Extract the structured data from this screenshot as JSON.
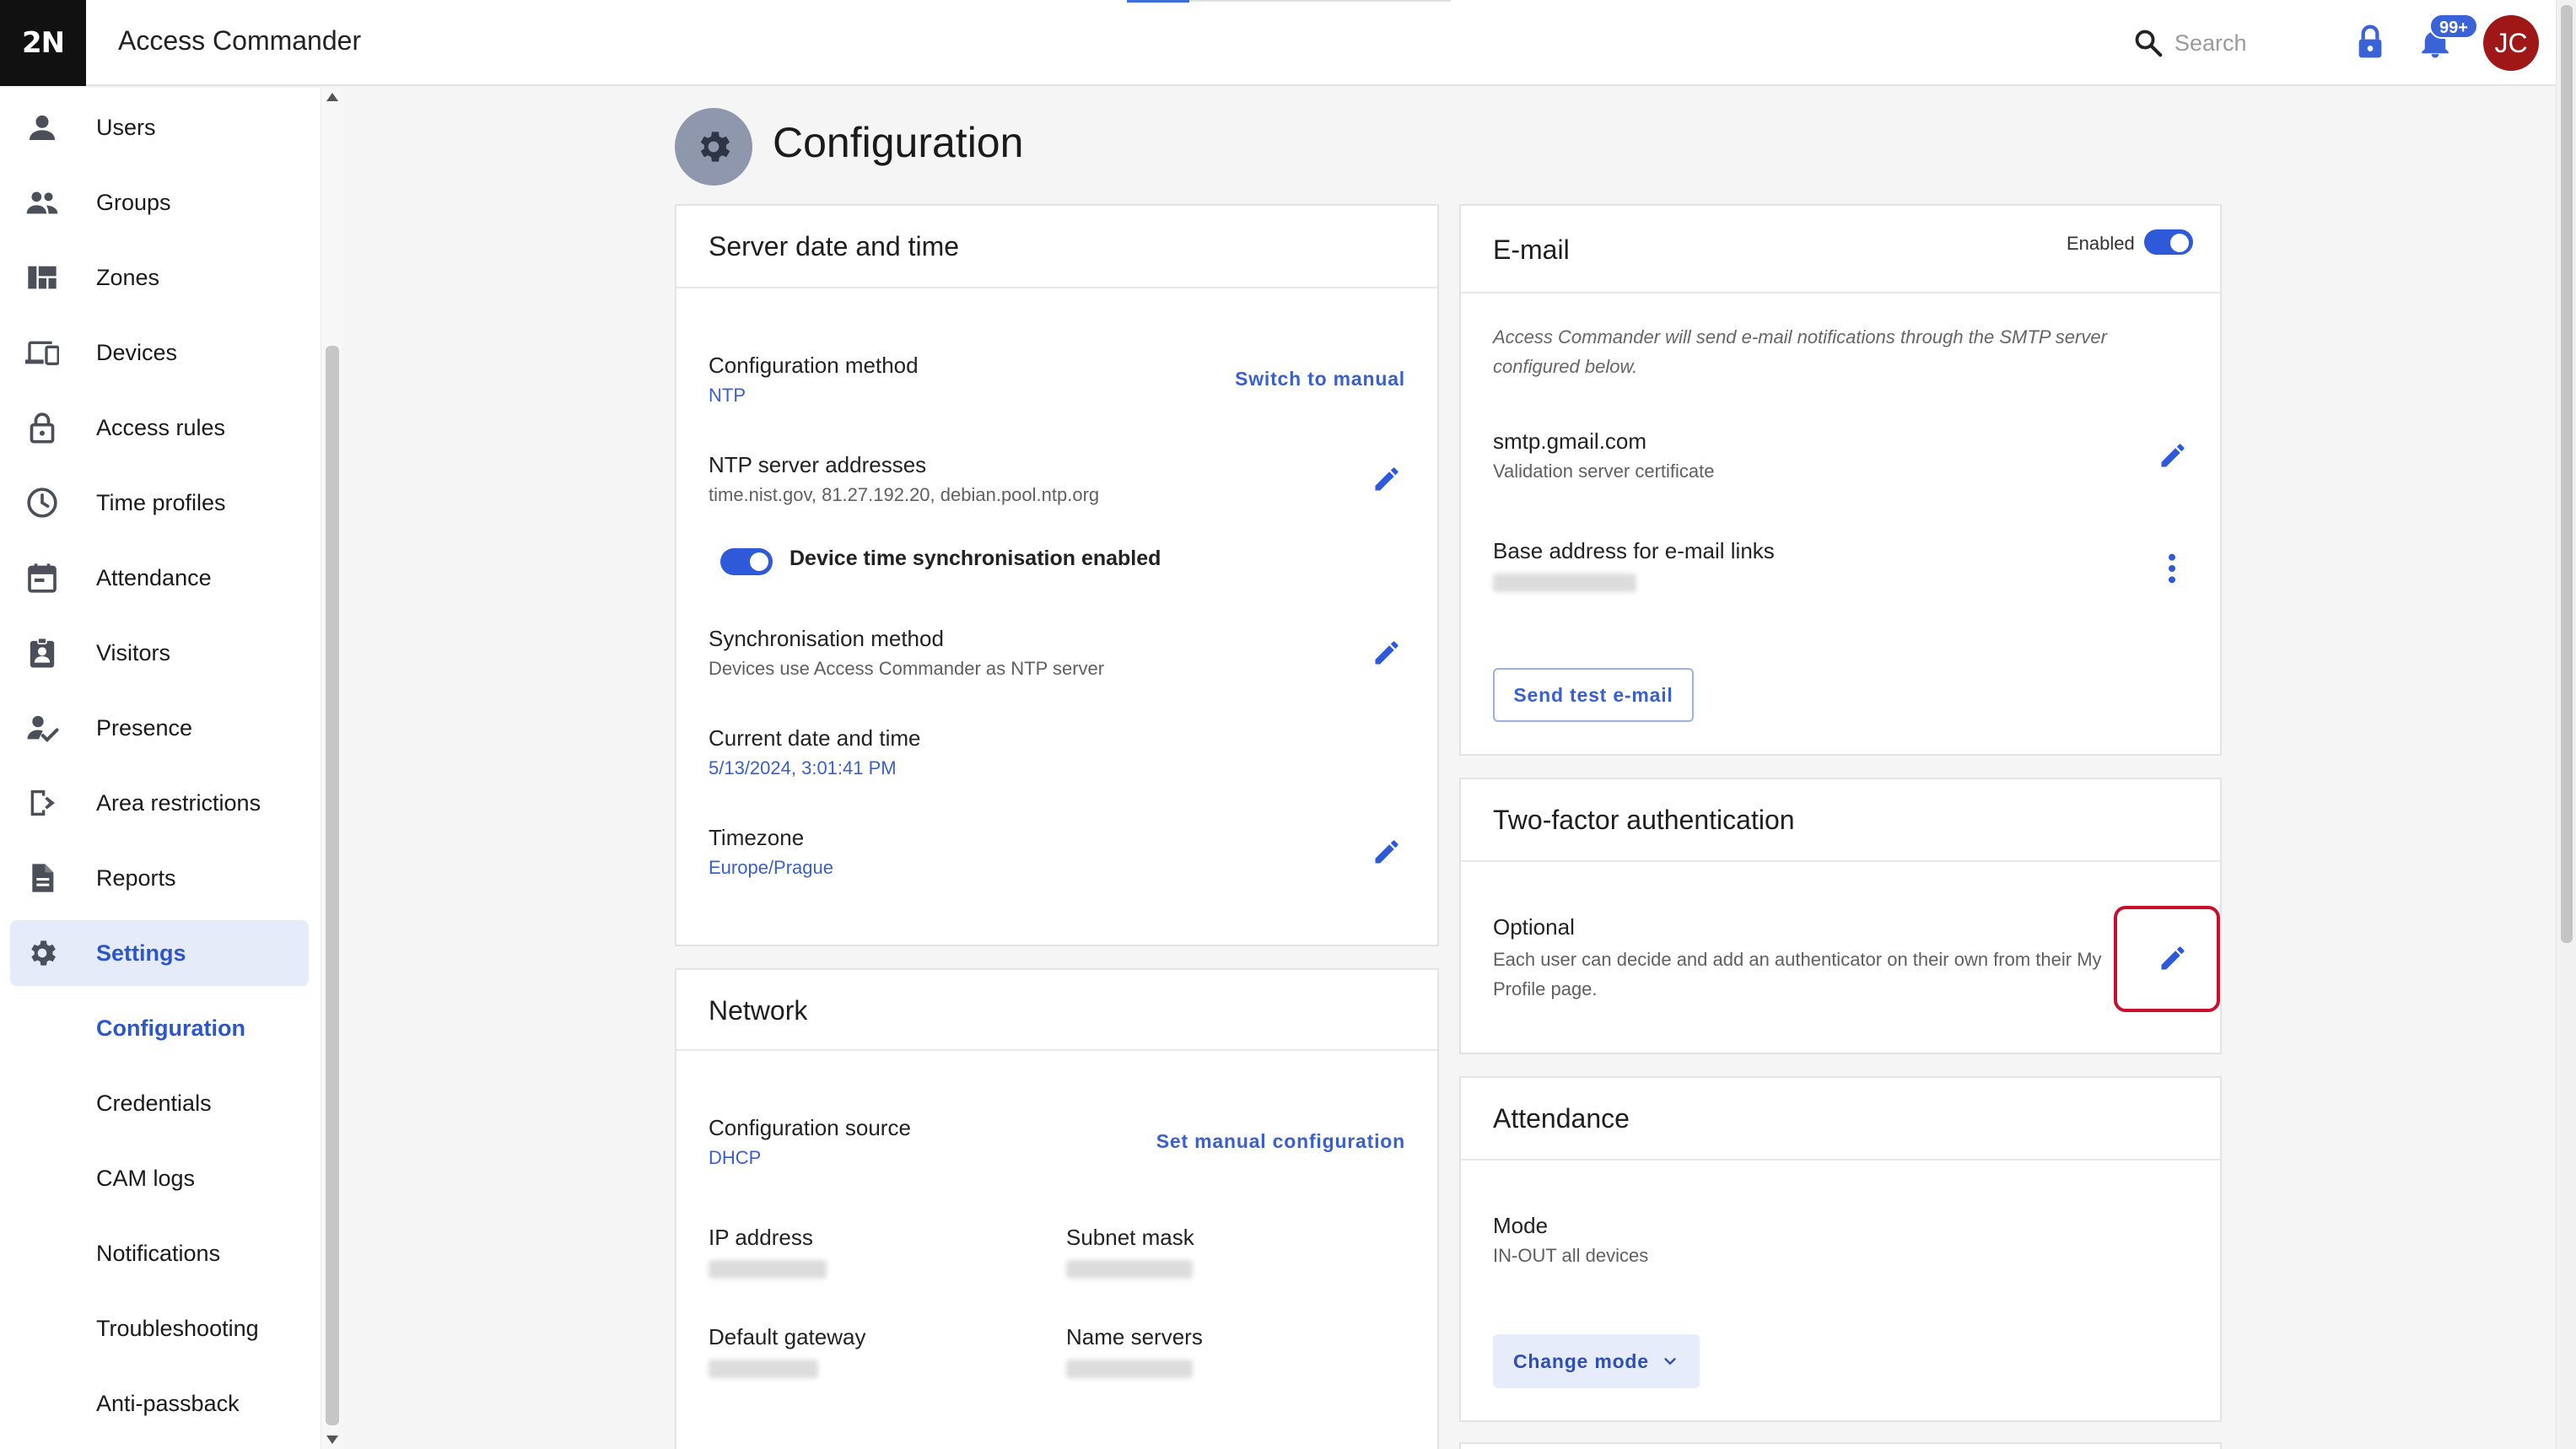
{
  "app": {
    "logo": "2N",
    "title": "Access Commander"
  },
  "search": {
    "placeholder": "Search"
  },
  "notifications": {
    "badge": "99+"
  },
  "user": {
    "initials": "JC"
  },
  "sidebar": {
    "items": [
      {
        "label": "Users",
        "icon": "user-icon"
      },
      {
        "label": "Groups",
        "icon": "group-icon"
      },
      {
        "label": "Zones",
        "icon": "zones-icon"
      },
      {
        "label": "Devices",
        "icon": "devices-icon"
      },
      {
        "label": "Access rules",
        "icon": "lock-icon"
      },
      {
        "label": "Time profiles",
        "icon": "clock-icon"
      },
      {
        "label": "Attendance",
        "icon": "calendar-icon"
      },
      {
        "label": "Visitors",
        "icon": "visitor-badge-icon"
      },
      {
        "label": "Presence",
        "icon": "presence-icon"
      },
      {
        "label": "Area restrictions",
        "icon": "area-restrictions-icon"
      },
      {
        "label": "Reports",
        "icon": "report-icon"
      },
      {
        "label": "Settings",
        "icon": "gear-icon"
      }
    ],
    "subitems": [
      {
        "label": "Configuration"
      },
      {
        "label": "Credentials"
      },
      {
        "label": "CAM logs"
      },
      {
        "label": "Notifications"
      },
      {
        "label": "Troubleshooting"
      },
      {
        "label": "Anti-passback"
      }
    ]
  },
  "page": {
    "title": "Configuration"
  },
  "server_time": {
    "title": "Server date and time",
    "config_method_label": "Configuration method",
    "config_method_value": "NTP",
    "switch_link": "Switch to manual",
    "ntp_label": "NTP server addresses",
    "ntp_value": "time.nist.gov, 81.27.192.20, debian.pool.ntp.org",
    "sync_toggle_label": "Device time synchronisation enabled",
    "sync_method_label": "Synchronisation method",
    "sync_method_value": "Devices use Access Commander as NTP server",
    "current_label": "Current date and time",
    "current_value": "5/13/2024, 3:01:41 PM",
    "timezone_label": "Timezone",
    "timezone_value": "Europe/Prague"
  },
  "network": {
    "title": "Network",
    "source_label": "Configuration source",
    "source_value": "DHCP",
    "manual_link": "Set manual configuration",
    "ip_label": "IP address",
    "subnet_label": "Subnet mask",
    "gateway_label": "Default gateway",
    "dns_label": "Name servers"
  },
  "email": {
    "title": "E-mail",
    "enabled_label": "Enabled",
    "note": "Access Commander will send e-mail notifications through the SMTP server configured below.",
    "smtp_label": "smtp.gmail.com",
    "smtp_value": "Validation server certificate",
    "base_label": "Base address for e-mail links",
    "test_button": "Send test e-mail"
  },
  "two_factor": {
    "title": "Two-factor authentication",
    "mode_label": "Optional",
    "mode_value": "Each user can decide and add an authenticator on their own from their My Profile page."
  },
  "attendance": {
    "title": "Attendance",
    "mode_label": "Mode",
    "mode_value": "IN-OUT all devices",
    "change_button": "Change mode"
  },
  "colors": {
    "accent": "#2e59d8",
    "link": "#3a5fd0",
    "avatar": "#a01717",
    "highlight": "#c8102e"
  }
}
